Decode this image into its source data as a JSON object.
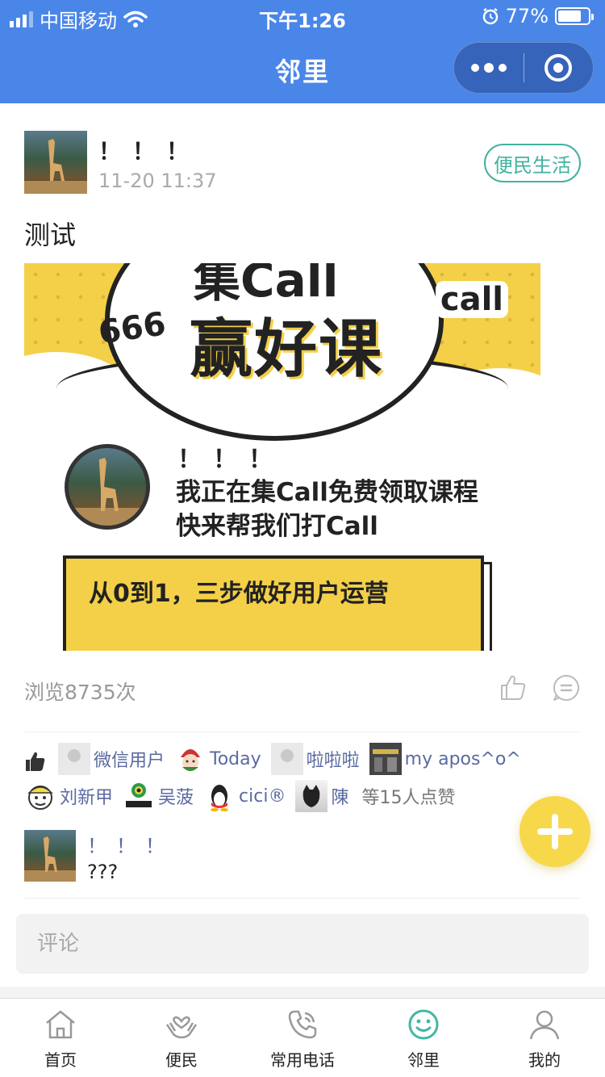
{
  "status_bar": {
    "carrier": "中国移动",
    "time": "下午1:26",
    "battery": "77%",
    "battery_level": 0.77
  },
  "nav": {
    "title": "邻里"
  },
  "post": {
    "author": "！！！",
    "time": "11-20 11:37",
    "tag": "便民生活",
    "text": "测试",
    "views": "浏览8735次"
  },
  "poster": {
    "title_top": "集Call",
    "title_main": "赢好课",
    "deco_num": "666",
    "deco_call": "call",
    "name": "！！！",
    "line1": "我正在集Call免费领取课程",
    "line2": "快来帮我们打Call",
    "card_text": "从0到1，三步做好用户运营"
  },
  "likers": [
    {
      "name": "微信用户"
    },
    {
      "name": "Today"
    },
    {
      "name": "啦啦啦"
    },
    {
      "name": "my apos^o^"
    },
    {
      "name": "刘新甲"
    },
    {
      "name": "吴菠"
    },
    {
      "name": "cici®"
    },
    {
      "name": "陳"
    }
  ],
  "likes_summary": "等15人点赞",
  "comment": {
    "author": "！！！",
    "text": "???"
  },
  "comment_input": {
    "placeholder": "评论"
  },
  "tabs": [
    {
      "label": "首页",
      "icon": "home-icon"
    },
    {
      "label": "便民",
      "icon": "heart-hands-icon"
    },
    {
      "label": "常用电话",
      "icon": "phone-icon"
    },
    {
      "label": "邻里",
      "icon": "smile-icon",
      "active": true
    },
    {
      "label": "我的",
      "icon": "user-icon"
    }
  ],
  "colors": {
    "header_blue": "#4a86e8",
    "tag_green": "#40b3a0",
    "active_tab": "#3fb8a6",
    "liker_name": "#5a6aa0",
    "fab_yellow": "#f7d84a",
    "poster_yellow": "#f4cf48"
  }
}
